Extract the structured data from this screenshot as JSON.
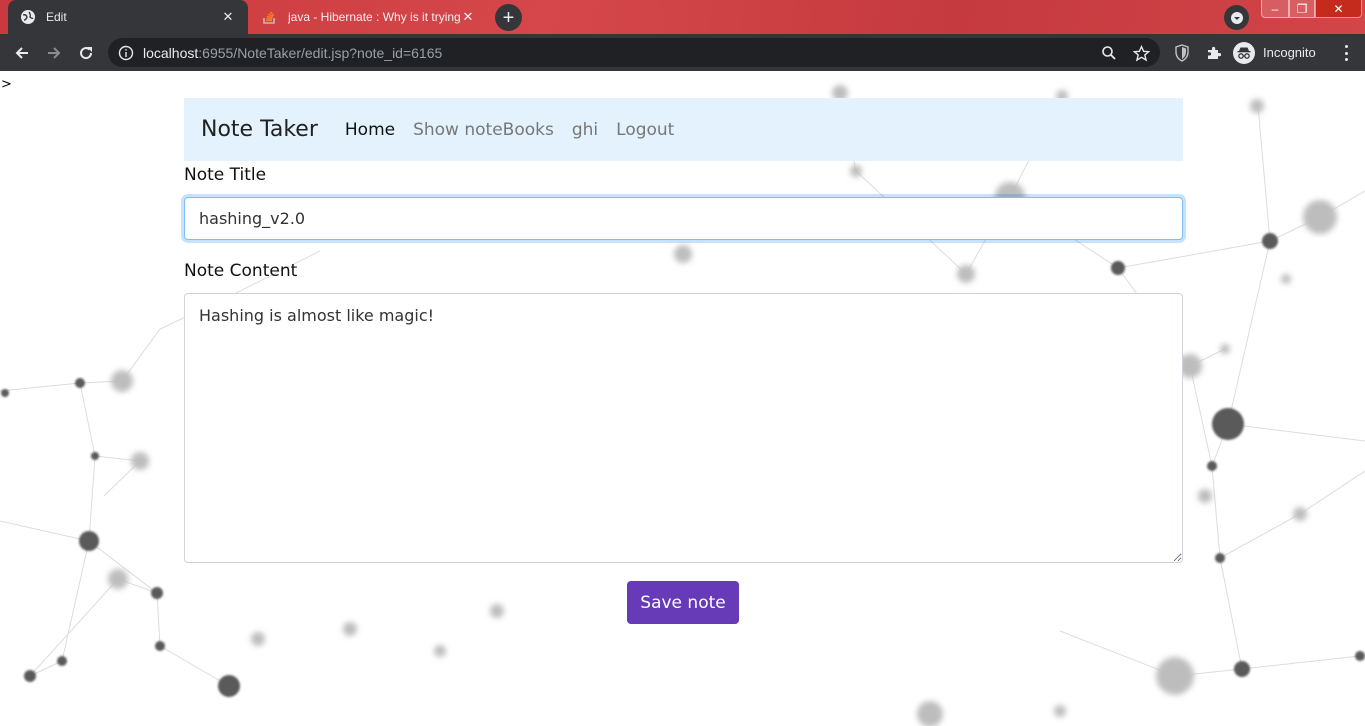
{
  "browser": {
    "tabs": [
      {
        "title": "Edit",
        "active": true,
        "favicon": "globe-icon"
      },
      {
        "title": "java - Hibernate : Why is it trying",
        "active": false,
        "favicon": "stackoverflow-icon"
      }
    ],
    "new_tab_label": "+",
    "url": {
      "host": "localhost",
      "rest": ":6955/NoteTaker/edit.jsp?note_id=6165"
    },
    "profile_label": "Incognito",
    "window_controls": {
      "minimize": "–",
      "maximize": "❐",
      "close": "✕"
    }
  },
  "page": {
    "stray_text": ">",
    "navbar": {
      "brand": "Note Taker",
      "links": [
        {
          "label": "Home",
          "active": true
        },
        {
          "label": "Show noteBooks",
          "active": false
        },
        {
          "label": "ghi",
          "active": false
        },
        {
          "label": "Logout",
          "active": false
        }
      ]
    },
    "form": {
      "title_label": "Note Title",
      "title_value": "hashing_v2.0",
      "content_label": "Note Content",
      "content_value": "Hashing is almost like magic!",
      "save_label": "Save note"
    }
  },
  "colors": {
    "navbar_bg": "#e3f2fd",
    "save_button": "#673ab7",
    "tabbar": "#d5474a",
    "toolbar": "#35363a"
  }
}
